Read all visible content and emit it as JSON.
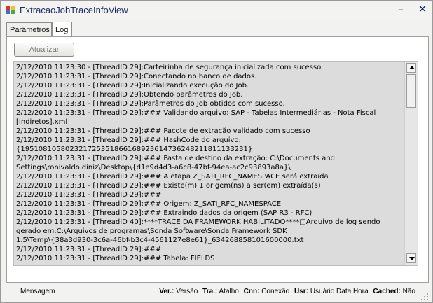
{
  "window": {
    "title": "ExtracaoJobTraceInfoView",
    "icon": "app-window-icon",
    "minimize_glyph": "–",
    "close_glyph": "✕"
  },
  "tabs": [
    {
      "label": "Parâmetros",
      "active": false
    },
    {
      "label": "Log",
      "active": true
    }
  ],
  "toolbar": {
    "refresh_label": "Atualizar"
  },
  "log": {
    "lines": [
      "2/12/2010 11:23:30 - [ThreadID 29]:Carteirinha de segurança inicializada com sucesso.",
      "2/12/2010 11:23:31 - [ThreadID 29]:Conectando no banco de dados.",
      "2/12/2010 11:23:31 - [ThreadID 29]:Inicializando execução do Job.",
      "2/12/2010 11:23:31 - [ThreadID 29]:Obtendo parâmetros do Job.",
      "2/12/2010 11:23:31 - [ThreadID 29]:Parâmetros do Job obtidos com sucesso.",
      "2/12/2010 11:23:31 - [ThreadID 29]:### Validando arquivo: SAP - Tabelas Intermediárias - Nota Fiscal",
      "[Indiretos].xml",
      "2/12/2010 11:23:31 - [ThreadID 29]:### Pacote de extração validado com sucesso",
      "2/12/2010 11:23:31 - [ThreadID 29]:### HashCode do arquivo:",
      "{195108105802321725351866168923614736248211811133231}",
      "2/12/2010 11:23:31 - [ThreadID 29]:### Pasta de destino da extração: C:\\Documents and",
      "Settings\\ronivaldo.diniz\\Desktop\\{d1e9d4d3-a6c8-47bf-94ea-ac2c93893a8a}\\",
      "2/12/2010 11:23:31 - [ThreadID 29]:### A etapa Z_SATI_RFC_NAMESPACE será extraída",
      "2/12/2010 11:23:31 - [ThreadID 29]:### Existe(m) 1 origem(ns) a ser(em) extraída(s)",
      "2/12/2010 11:23:31 - [ThreadID 29]:###",
      "2/12/2010 11:23:31 - [ThreadID 29]:### Origem: Z_SATI_RFC_NAMESPACE",
      "2/12/2010 11:23:31 - [ThreadID 29]:### Extraindo dados da origem (SAP R3 - RFC)",
      "2/12/2010 11:23:31 - [ThreadID 40]:****TRACE DA FRAMEWORK HABILITADO****□Arquivo de log sendo",
      "gerado em:C:\\Arquivos de programas\\Sonda Software\\Sonda Framework SDK",
      "1.5\\Temp\\{38a3d930-3c6a-46bf-b3c4-4561127e8e61}_634268858101600000.txt",
      "2/12/2010 11:23:31 - [ThreadID 29]:###",
      "2/12/2010 11:23:31 - [ThreadID 29]:### Tabela: FIELDS"
    ]
  },
  "statusbar": {
    "message": "Mensagem",
    "fields": [
      {
        "key": "Ver.:",
        "value": "Versão"
      },
      {
        "key": "Tra.:",
        "value": "Atalho"
      },
      {
        "key": "Cnn:",
        "value": "Conexão"
      },
      {
        "key": "Usr:",
        "value": "Usuário Data Hora"
      },
      {
        "key": "Cached:",
        "value": "Não"
      }
    ]
  },
  "colors": {
    "title_text": "#1c2e66",
    "log_background": "#dcdcdc",
    "window_background": "#f2f2f0"
  }
}
